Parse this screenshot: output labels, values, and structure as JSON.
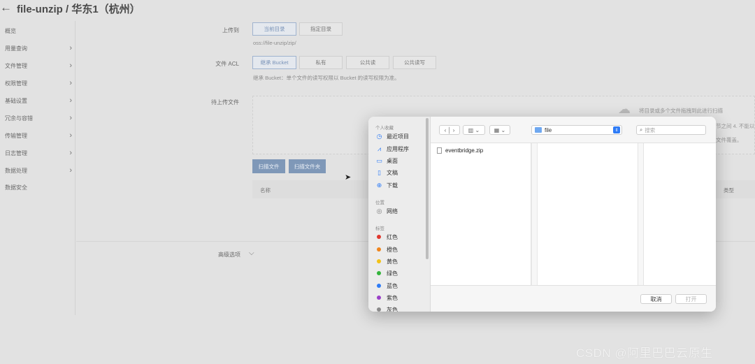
{
  "header": {
    "title": "file-unzip / 华东1（杭州）"
  },
  "sidebar": {
    "items": [
      {
        "label": "概览",
        "has_chevron": false
      },
      {
        "label": "用量查询",
        "has_chevron": true
      },
      {
        "label": "文件管理",
        "has_chevron": true
      },
      {
        "label": "权限管理",
        "has_chevron": true
      },
      {
        "label": "基础设置",
        "has_chevron": true
      },
      {
        "label": "冗余与容错",
        "has_chevron": true
      },
      {
        "label": "传输管理",
        "has_chevron": true
      },
      {
        "label": "日志管理",
        "has_chevron": true
      },
      {
        "label": "数据处理",
        "has_chevron": true
      },
      {
        "label": "数据安全",
        "has_chevron": false
      }
    ]
  },
  "form": {
    "upload_to": {
      "label": "上传到",
      "options": [
        "当前目录",
        "指定目录"
      ],
      "path": "oss://file-unzip/zip/"
    },
    "acl": {
      "label": "文件 ACL",
      "options": [
        "继承 Bucket",
        "私有",
        "公共读",
        "公共读写"
      ],
      "hint": "继承 Bucket：单个文件的读写权限以 Bucket 的读写权限为准。"
    },
    "pending": {
      "label": "待上传文件",
      "drop_hint": "将目录或多个文件拖拽到此进行扫描",
      "note_line1": "节之间 4. 不能以",
      "note_line2": "文件覆盖。"
    },
    "buttons": {
      "scan_files": "扫描文件",
      "scan_folder": "扫描文件夹"
    },
    "table": {
      "col_name": "名称",
      "col_type": "类型"
    },
    "advanced": "高级选项"
  },
  "dialog": {
    "sections": {
      "favorites": "个人收藏",
      "locations": "位置",
      "tags": "标签"
    },
    "favorites": [
      {
        "label": "最近项目",
        "icon": "clock-icon"
      },
      {
        "label": "应用程序",
        "icon": "apps-icon"
      },
      {
        "label": "桌面",
        "icon": "desktop-icon"
      },
      {
        "label": "文稿",
        "icon": "document-icon"
      },
      {
        "label": "下载",
        "icon": "download-icon"
      }
    ],
    "locations": [
      {
        "label": "网络",
        "icon": "network-icon"
      }
    ],
    "tags": [
      {
        "label": "红色",
        "color": "#e0382f"
      },
      {
        "label": "橙色",
        "color": "#f0851d"
      },
      {
        "label": "黄色",
        "color": "#f3c217"
      },
      {
        "label": "绿色",
        "color": "#34b43c"
      },
      {
        "label": "蓝色",
        "color": "#2f7cf6"
      },
      {
        "label": "紫色",
        "color": "#9a40c8"
      },
      {
        "label": "灰色",
        "color": "#8a8a8a"
      }
    ],
    "path": "file",
    "search_placeholder": "搜索",
    "files": [
      {
        "name": "eventbridge.zip"
      }
    ],
    "cancel": "取消",
    "open": "打开"
  },
  "watermark": "CSDN @阿里巴巴云原生"
}
